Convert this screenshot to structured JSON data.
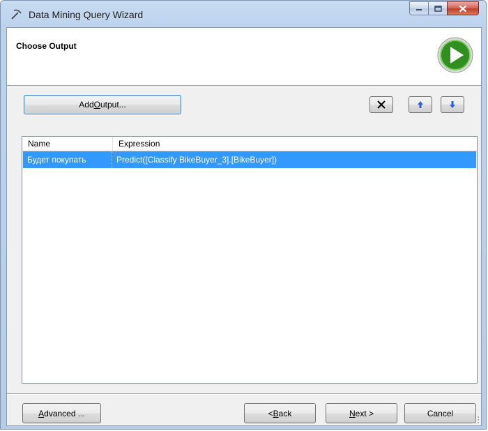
{
  "window": {
    "title": "Data Mining Query Wizard"
  },
  "header": {
    "title": "Choose Output"
  },
  "toolbar": {
    "add_output_pre": "Add ",
    "add_output_mnemonic": "O",
    "add_output_post": "utput..."
  },
  "list": {
    "columns": [
      "Name",
      "Expression"
    ],
    "rows": [
      {
        "name": "Будет покупать",
        "expression": "Predict([Classify BikeBuyer_3].[BikeBuyer])",
        "selected": true
      }
    ]
  },
  "footer": {
    "advanced_mnemonic": "A",
    "advanced_post": "dvanced ...",
    "back_pre": "< ",
    "back_mnemonic": "B",
    "back_post": "ack",
    "next_mnemonic": "N",
    "next_post": "ext >",
    "cancel_label": "Cancel"
  },
  "colors": {
    "selection": "#3399ff",
    "logo_green": "#2f8f1f"
  }
}
